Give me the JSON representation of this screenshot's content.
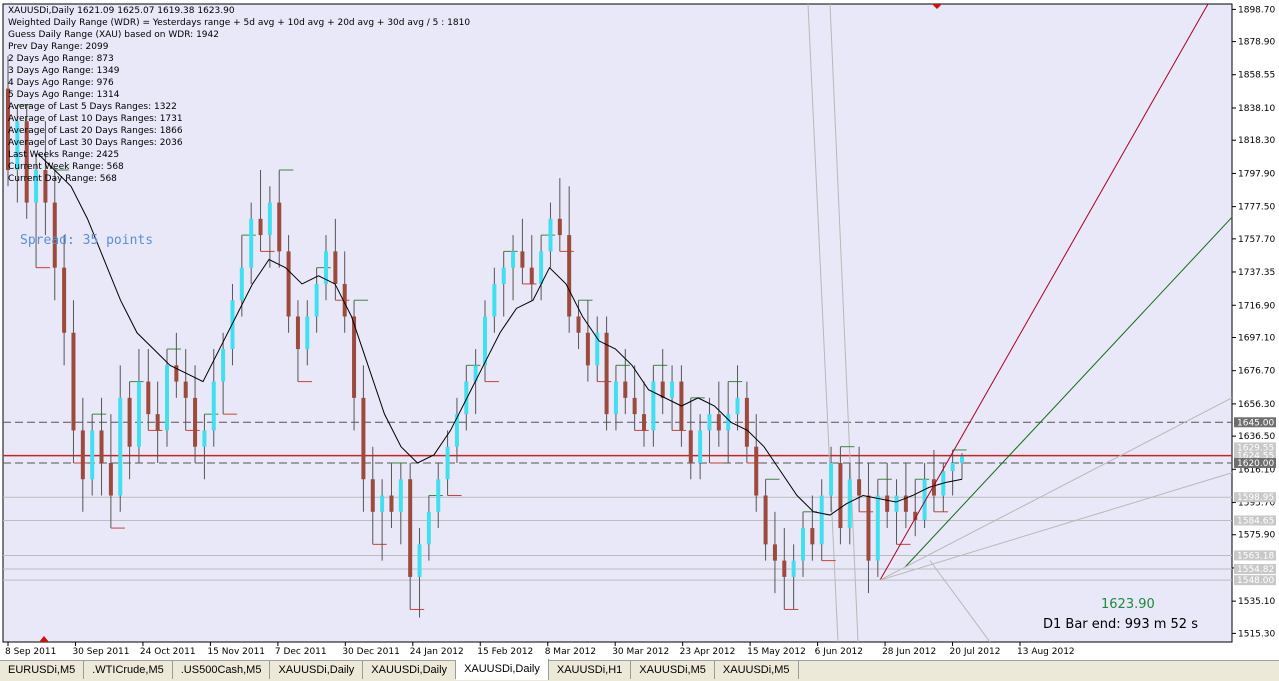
{
  "chart_data": {
    "type": "candlestick",
    "header_line": "XAUUSDi,Daily  1621.09 1625.07 1619.38 1623.90",
    "info_lines": [
      "Weighted Daily Range (WDR) = Yesterdays range + 5d avg + 10d avg + 20d avg + 30d avg / 5 : 1810",
      "Guess Daily Range (XAU) based on WDR: 1942",
      "Prev Day Range: 2099",
      "2 Days Ago Range: 873",
      "3 Days Ago Range: 1349",
      "4 Days Ago Range: 976",
      "5 Days Ago Range: 1314",
      "Average of Last 5 Days Ranges: 1322",
      "Average of Last 10 Days Ranges: 1731",
      "Average of Last 20 Days Ranges: 1866",
      "Average of Last 30 Days Ranges: 2036",
      "Last Weeks Range: 2425",
      "Current Week Range: 568",
      "Current Day Range: 568"
    ],
    "spread_text": "Spread: 35 points",
    "last_price_text": "1623.90",
    "bar_end_text": "D1 Bar end: 993 m 52 s",
    "y_ticks": [
      "1898.70",
      "1878.90",
      "1858.55",
      "1838.10",
      "1818.30",
      "1797.90",
      "1777.50",
      "1757.70",
      "1737.35",
      "1716.90",
      "1697.10",
      "1676.70",
      "1656.30",
      "1636.50",
      "1616.10",
      "1595.70",
      "1575.90",
      "1555.50",
      "1535.10",
      "1515.30"
    ],
    "y_range": [
      1510,
      1902
    ],
    "x_labels": [
      "8 Sep 2011",
      "30 Sep 2011",
      "24 Oct 2011",
      "15 Nov 2011",
      "7 Dec 2011",
      "30 Dec 2011",
      "24 Jan 2012",
      "15 Feb 2012",
      "8 Mar 2012",
      "30 Mar 2012",
      "23 Apr 2012",
      "15 May 2012",
      "6 Jun 2012",
      "28 Jun 2012",
      "20 Jul 2012",
      "13 Aug 2012"
    ],
    "price_tags": [
      {
        "text": "1645.00",
        "value": 1645.0,
        "bg": "#6e6e6e"
      },
      {
        "text": "1629.55",
        "value": 1629.55,
        "bg": "#c8c8c8"
      },
      {
        "text": "1624.55",
        "value": 1624.55,
        "bg": "#c8c8c8"
      },
      {
        "text": "1620.00",
        "value": 1620.0,
        "bg": "#6e6e6e"
      },
      {
        "text": "1598.95",
        "value": 1598.95,
        "bg": "#c8c8c8"
      },
      {
        "text": "1584.65",
        "value": 1584.65,
        "bg": "#c8c8c8"
      },
      {
        "text": "1563.18",
        "value": 1563.18,
        "bg": "#c8c8c8"
      },
      {
        "text": "1554.82",
        "value": 1554.82,
        "bg": "#c8c8c8"
      },
      {
        "text": "1548.00",
        "value": 1548.0,
        "bg": "#c8c8c8"
      }
    ],
    "horizontal_levels": [
      {
        "value": 1645.0,
        "color": "#555555",
        "style": "dashed"
      },
      {
        "value": 1620.0,
        "color": "#555555",
        "style": "dashed"
      },
      {
        "value": 1624.55,
        "color": "#cc2222",
        "style": "solid"
      },
      {
        "value": 1598.95,
        "color": "#bdbdbd",
        "style": "solid"
      },
      {
        "value": 1584.65,
        "color": "#bdbdbd",
        "style": "solid"
      },
      {
        "value": 1563.18,
        "color": "#bdbdbd",
        "style": "solid"
      },
      {
        "value": 1554.82,
        "color": "#bdbdbd",
        "style": "solid"
      },
      {
        "value": 1548.0,
        "color": "#bdbdbd",
        "style": "solid"
      }
    ],
    "colors": {
      "background": "#e8e8f8",
      "bull_candle": "#40e0f0",
      "bear_candle": "#9b4a3c",
      "wick": "#555555",
      "moving_average": "#000000",
      "fan_red": "#aa0022",
      "fan_green": "#107010",
      "fan_grey": "#b8b8b8",
      "pivot_high": "#3a8a3a",
      "pivot_low": "#d04030",
      "arrow_marker": "#cc1111"
    },
    "candles_ohlc": [
      [
        1850,
        1870,
        1790,
        1800
      ],
      [
        1800,
        1840,
        1780,
        1830
      ],
      [
        1830,
        1840,
        1770,
        1780
      ],
      [
        1780,
        1810,
        1740,
        1800
      ],
      [
        1800,
        1830,
        1760,
        1780
      ],
      [
        1780,
        1800,
        1720,
        1740
      ],
      [
        1740,
        1760,
        1680,
        1700
      ],
      [
        1700,
        1720,
        1620,
        1640
      ],
      [
        1640,
        1660,
        1590,
        1610
      ],
      [
        1610,
        1650,
        1600,
        1640
      ],
      [
        1640,
        1660,
        1600,
        1620
      ],
      [
        1620,
        1650,
        1580,
        1600
      ],
      [
        1600,
        1680,
        1590,
        1660
      ],
      [
        1660,
        1670,
        1610,
        1630
      ],
      [
        1630,
        1690,
        1620,
        1670
      ],
      [
        1670,
        1690,
        1640,
        1650
      ],
      [
        1650,
        1670,
        1620,
        1640
      ],
      [
        1640,
        1690,
        1630,
        1680
      ],
      [
        1680,
        1700,
        1660,
        1670
      ],
      [
        1670,
        1690,
        1640,
        1660
      ],
      [
        1660,
        1680,
        1620,
        1630
      ],
      [
        1630,
        1650,
        1610,
        1640
      ],
      [
        1640,
        1690,
        1630,
        1670
      ],
      [
        1670,
        1700,
        1650,
        1690
      ],
      [
        1690,
        1730,
        1680,
        1720
      ],
      [
        1720,
        1760,
        1710,
        1740
      ],
      [
        1740,
        1780,
        1730,
        1770
      ],
      [
        1770,
        1800,
        1750,
        1760
      ],
      [
        1760,
        1790,
        1740,
        1780
      ],
      [
        1780,
        1800,
        1740,
        1750
      ],
      [
        1750,
        1760,
        1700,
        1710
      ],
      [
        1710,
        1720,
        1670,
        1690
      ],
      [
        1690,
        1720,
        1680,
        1710
      ],
      [
        1710,
        1740,
        1700,
        1730
      ],
      [
        1730,
        1760,
        1720,
        1750
      ],
      [
        1750,
        1770,
        1720,
        1730
      ],
      [
        1730,
        1750,
        1700,
        1710
      ],
      [
        1710,
        1720,
        1640,
        1660
      ],
      [
        1660,
        1680,
        1590,
        1610
      ],
      [
        1610,
        1630,
        1570,
        1590
      ],
      [
        1590,
        1610,
        1560,
        1600
      ],
      [
        1600,
        1620,
        1580,
        1590
      ],
      [
        1590,
        1620,
        1570,
        1610
      ],
      [
        1610,
        1620,
        1530,
        1550
      ],
      [
        1550,
        1580,
        1525,
        1570
      ],
      [
        1570,
        1600,
        1560,
        1590
      ],
      [
        1590,
        1620,
        1580,
        1610
      ],
      [
        1610,
        1640,
        1600,
        1630
      ],
      [
        1630,
        1660,
        1620,
        1650
      ],
      [
        1650,
        1680,
        1640,
        1670
      ],
      [
        1670,
        1690,
        1650,
        1680
      ],
      [
        1680,
        1720,
        1670,
        1710
      ],
      [
        1710,
        1740,
        1700,
        1730
      ],
      [
        1730,
        1750,
        1710,
        1740
      ],
      [
        1740,
        1760,
        1720,
        1750
      ],
      [
        1750,
        1770,
        1730,
        1740
      ],
      [
        1740,
        1760,
        1720,
        1730
      ],
      [
        1730,
        1760,
        1720,
        1750
      ],
      [
        1750,
        1780,
        1740,
        1770
      ],
      [
        1770,
        1795,
        1750,
        1760
      ],
      [
        1760,
        1790,
        1700,
        1710
      ],
      [
        1710,
        1720,
        1690,
        1700
      ],
      [
        1700,
        1720,
        1670,
        1680
      ],
      [
        1680,
        1710,
        1670,
        1700
      ],
      [
        1700,
        1710,
        1640,
        1650
      ],
      [
        1650,
        1680,
        1640,
        1670
      ],
      [
        1670,
        1690,
        1650,
        1660
      ],
      [
        1660,
        1680,
        1640,
        1650
      ],
      [
        1650,
        1670,
        1630,
        1640
      ],
      [
        1640,
        1680,
        1630,
        1670
      ],
      [
        1670,
        1690,
        1650,
        1660
      ],
      [
        1660,
        1680,
        1640,
        1670
      ],
      [
        1670,
        1680,
        1630,
        1640
      ],
      [
        1640,
        1660,
        1610,
        1620
      ],
      [
        1620,
        1650,
        1610,
        1640
      ],
      [
        1640,
        1660,
        1620,
        1650
      ],
      [
        1650,
        1670,
        1630,
        1640
      ],
      [
        1640,
        1670,
        1620,
        1650
      ],
      [
        1650,
        1680,
        1640,
        1660
      ],
      [
        1660,
        1670,
        1620,
        1630
      ],
      [
        1630,
        1650,
        1590,
        1600
      ],
      [
        1600,
        1610,
        1560,
        1570
      ],
      [
        1570,
        1590,
        1540,
        1560
      ],
      [
        1560,
        1580,
        1530,
        1550
      ],
      [
        1550,
        1570,
        1530,
        1560
      ],
      [
        1560,
        1590,
        1550,
        1580
      ],
      [
        1580,
        1600,
        1560,
        1570
      ],
      [
        1570,
        1610,
        1560,
        1600
      ],
      [
        1600,
        1630,
        1590,
        1620
      ],
      [
        1620,
        1630,
        1570,
        1580
      ],
      [
        1580,
        1620,
        1570,
        1610
      ],
      [
        1610,
        1630,
        1590,
        1600
      ],
      [
        1600,
        1620,
        1540,
        1560
      ],
      [
        1560,
        1610,
        1550,
        1600
      ],
      [
        1600,
        1620,
        1580,
        1590
      ],
      [
        1590,
        1610,
        1570,
        1600
      ],
      [
        1600,
        1620,
        1580,
        1590
      ],
      [
        1590,
        1610,
        1575,
        1585
      ],
      [
        1585,
        1620,
        1580,
        1610
      ],
      [
        1610,
        1628,
        1590,
        1600
      ],
      [
        1600,
        1620,
        1590,
        1615
      ],
      [
        1615,
        1628,
        1600,
        1620
      ],
      [
        1620,
        1626,
        1610,
        1624
      ]
    ],
    "moving_average_values": [
      1810,
      1800,
      1790,
      1770,
      1745,
      1720,
      1700,
      1690,
      1680,
      1675,
      1670,
      1690,
      1710,
      1730,
      1745,
      1740,
      1730,
      1735,
      1730,
      1710,
      1680,
      1650,
      1630,
      1620,
      1625,
      1640,
      1660,
      1680,
      1700,
      1715,
      1720,
      1740,
      1730,
      1710,
      1695,
      1690,
      1680,
      1665,
      1660,
      1655,
      1660,
      1655,
      1645,
      1640,
      1630,
      1615,
      1600,
      1590,
      1588,
      1595,
      1600,
      1598,
      1596,
      1600,
      1605,
      1608,
      1610
    ]
  },
  "tabs": [
    {
      "label": "EURUSDi,M5",
      "active": false
    },
    {
      "label": ".WTICrude,M5",
      "active": false
    },
    {
      "label": ".US500Cash,M5",
      "active": false
    },
    {
      "label": "XAUUSDi,Daily",
      "active": false
    },
    {
      "label": "XAUUSDi,Daily",
      "active": false
    },
    {
      "label": "XAUUSDi,Daily",
      "active": true
    },
    {
      "label": "XAUUSDi,H1",
      "active": false
    },
    {
      "label": "XAUUSDi,M5",
      "active": false
    },
    {
      "label": "XAUUSDi,M5",
      "active": false
    }
  ]
}
